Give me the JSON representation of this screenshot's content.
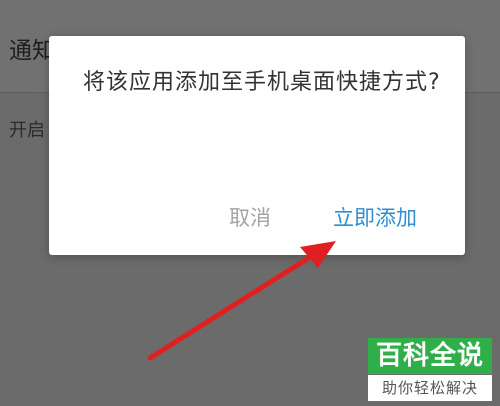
{
  "background": {
    "title_fragment": "通知",
    "row_fragment": "开启"
  },
  "dialog": {
    "message": "将该应用添加至手机桌面快捷方式?",
    "cancel_label": "取消",
    "confirm_label": "立即添加"
  },
  "annotation": {
    "arrow_color": "#e02020"
  },
  "watermark": {
    "title": "百科全说",
    "subtitle": "助你轻松解决",
    "color": "#2fae4a"
  }
}
